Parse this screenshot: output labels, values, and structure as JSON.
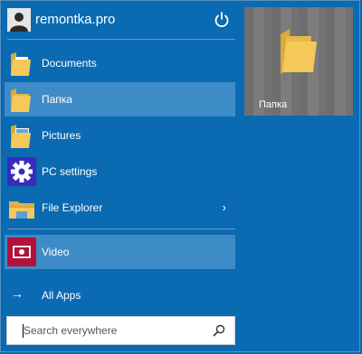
{
  "user": {
    "name": "remontka.pro"
  },
  "menu": {
    "items": [
      {
        "label": "Documents",
        "icon": "documents-folder-icon",
        "highlighted": false
      },
      {
        "label": "Папка",
        "icon": "folder-icon",
        "highlighted": true
      },
      {
        "label": "Pictures",
        "icon": "pictures-folder-icon",
        "highlighted": false
      },
      {
        "label": "PC settings",
        "icon": "gear-icon",
        "highlighted": false
      },
      {
        "label": "File Explorer",
        "icon": "file-explorer-icon",
        "highlighted": false,
        "submenu_indicator": "›"
      },
      {
        "label": "Video",
        "icon": "video-icon",
        "highlighted": true
      }
    ],
    "all_apps": {
      "label": "All Apps",
      "arrow": "→"
    }
  },
  "search": {
    "placeholder": "Search everywhere",
    "value": ""
  },
  "tile": {
    "label": "Папка",
    "icon": "folder-icon"
  },
  "colors": {
    "background": "#0a6ab2",
    "highlight": "#3d8cc7",
    "tile": "#7a7a7a",
    "folder": "#f4c95a",
    "settings_icon_bg": "#3a2bbf",
    "video_icon_bg": "#b3123a"
  }
}
